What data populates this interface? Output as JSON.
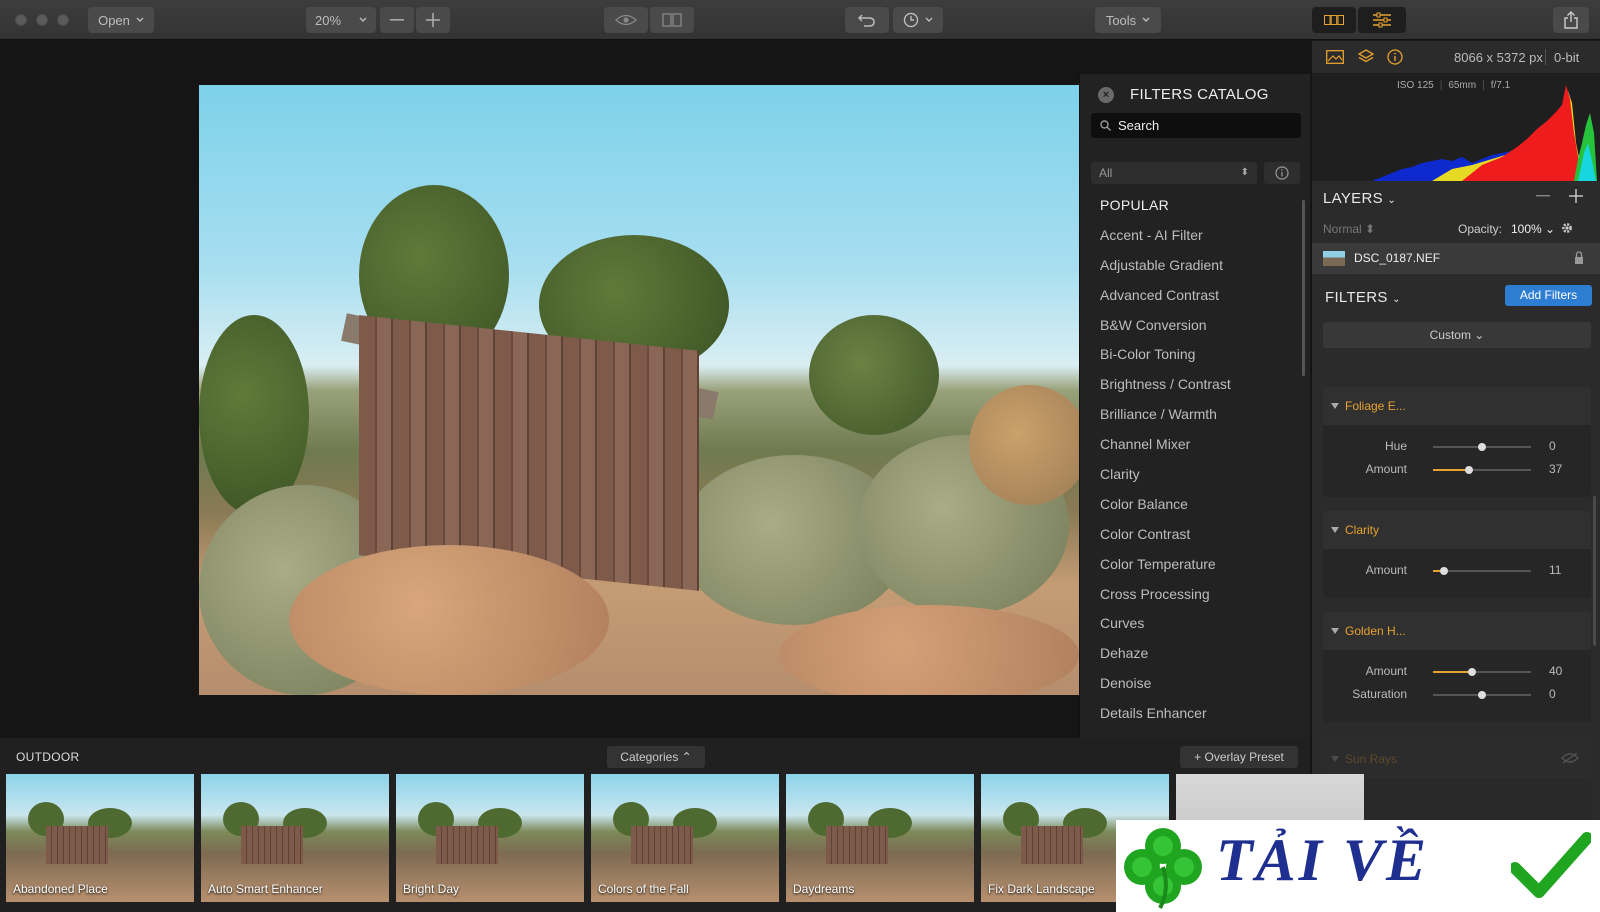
{
  "toolbar": {
    "open_label": "Open",
    "zoom_value": "20%",
    "tools_label": "Tools",
    "icons": [
      "close-dot-icon",
      "minimize-dot-icon",
      "fullscreen-dot-icon",
      "zoom-out-icon",
      "zoom-in-icon",
      "eye-icon",
      "compare-icon",
      "undo-icon",
      "history-icon",
      "filmstrip-icon",
      "adjustments-icon",
      "share-icon"
    ]
  },
  "catalog": {
    "title": "FILTERS CATALOG",
    "search_placeholder": "Search",
    "category_select": "All",
    "items": [
      {
        "label": "POPULAR",
        "header": true
      },
      {
        "label": "Accent - AI Filter"
      },
      {
        "label": "Adjustable Gradient"
      },
      {
        "label": "Advanced Contrast"
      },
      {
        "label": "B&W Conversion"
      },
      {
        "label": "Bi-Color Toning"
      },
      {
        "label": "Brightness / Contrast"
      },
      {
        "label": "Brilliance / Warmth"
      },
      {
        "label": "Channel Mixer"
      },
      {
        "label": "Clarity"
      },
      {
        "label": "Color Balance"
      },
      {
        "label": "Color Contrast"
      },
      {
        "label": "Color Temperature"
      },
      {
        "label": "Cross Processing"
      },
      {
        "label": "Curves"
      },
      {
        "label": "Dehaze"
      },
      {
        "label": "Denoise"
      },
      {
        "label": "Details Enhancer"
      }
    ]
  },
  "info": {
    "resolution": "8066 x 5372 px",
    "bit_depth": "0-bit",
    "iso": "ISO 125",
    "focal": "65mm",
    "aperture": "f/7.1"
  },
  "layers": {
    "title": "LAYERS",
    "blend_mode": "Normal",
    "opacity_label": "Opacity:",
    "opacity_value": "100%",
    "layer_name": "DSC_0187.NEF"
  },
  "filters": {
    "title": "FILTERS",
    "add_label": "Add Filters",
    "preset_label": "Custom",
    "blocks": [
      {
        "name": "Foliage E...",
        "sliders": [
          {
            "label": "Hue",
            "value": "0",
            "pos": 0.5,
            "fill": false
          },
          {
            "label": "Amount",
            "value": "37",
            "pos": 0.37,
            "fill": true
          }
        ]
      },
      {
        "name": "Clarity",
        "sliders": [
          {
            "label": "Amount",
            "value": "11",
            "pos": 0.11,
            "fill": true
          }
        ]
      },
      {
        "name": "Golden H...",
        "sliders": [
          {
            "label": "Amount",
            "value": "40",
            "pos": 0.4,
            "fill": true
          },
          {
            "label": "Saturation",
            "value": "0",
            "pos": 0.5,
            "fill": false
          }
        ]
      }
    ],
    "faded_block": "Sun Rays"
  },
  "bottom": {
    "category": "OUTDOOR",
    "categories_label": "Categories",
    "overlay_label": "+ Overlay Preset",
    "presets": [
      "Abandoned Place",
      "Auto Smart Enhancer",
      "Bright Day",
      "Colors of the Fall",
      "Daydreams",
      "Fix Dark Landscape",
      ""
    ]
  },
  "banner": {
    "text": "TẢI VỀ"
  }
}
